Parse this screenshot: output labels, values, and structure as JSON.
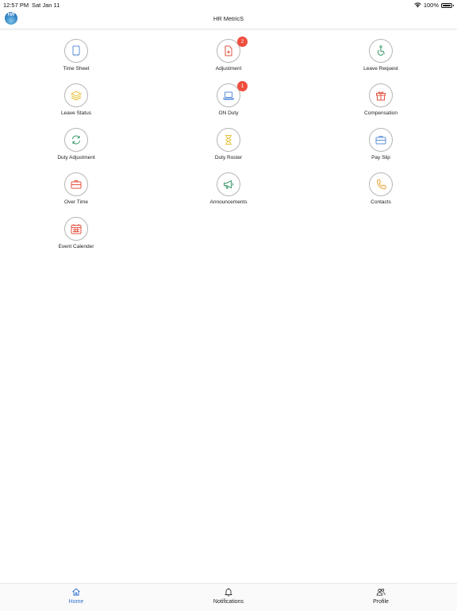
{
  "status_bar": {
    "time": "12:57 PM",
    "date": "Sat Jan 11",
    "battery": "100%"
  },
  "nav": {
    "logo_text": "HR",
    "title": "HR MetricS"
  },
  "tiles": [
    {
      "label": "Time Sheet",
      "icon": "document-icon",
      "color": "#5b8fd8"
    },
    {
      "label": "Adjustment",
      "icon": "document-plus-icon",
      "color": "#e0533f",
      "badge": "2"
    },
    {
      "label": "Leave Request",
      "icon": "wheelchair-icon",
      "color": "#3a9a6a"
    },
    {
      "label": "Leave Status",
      "icon": "layers-icon",
      "color": "#e8c23a"
    },
    {
      "label": "ON Duty",
      "icon": "laptop-icon",
      "color": "#5b8fd8",
      "badge": "1"
    },
    {
      "label": "Compensation",
      "icon": "gift-icon",
      "color": "#e0533f"
    },
    {
      "label": "Duty Adjustment",
      "icon": "refresh-icon",
      "color": "#3a9a6a"
    },
    {
      "label": "Duty Roster",
      "icon": "hourglass-icon",
      "color": "#e8c23a"
    },
    {
      "label": "Pay Slip",
      "icon": "briefcase-icon",
      "color": "#5b8fd8"
    },
    {
      "label": "Over Time",
      "icon": "briefcase-icon",
      "color": "#e0533f"
    },
    {
      "label": "Announcements",
      "icon": "megaphone-icon",
      "color": "#3a9a6a"
    },
    {
      "label": "Contacts",
      "icon": "phone-icon",
      "color": "#e8a53a"
    },
    {
      "label": "Event Calender",
      "icon": "calendar-icon",
      "color": "#e0533f"
    }
  ],
  "tabs": [
    {
      "label": "Home",
      "icon": "home-icon",
      "active": true
    },
    {
      "label": "Notifications",
      "icon": "bell-icon",
      "active": false
    },
    {
      "label": "Profile",
      "icon": "users-icon",
      "active": false
    }
  ],
  "colors": {
    "accent": "#2f6fd0",
    "badge": "#ef4e3f"
  }
}
